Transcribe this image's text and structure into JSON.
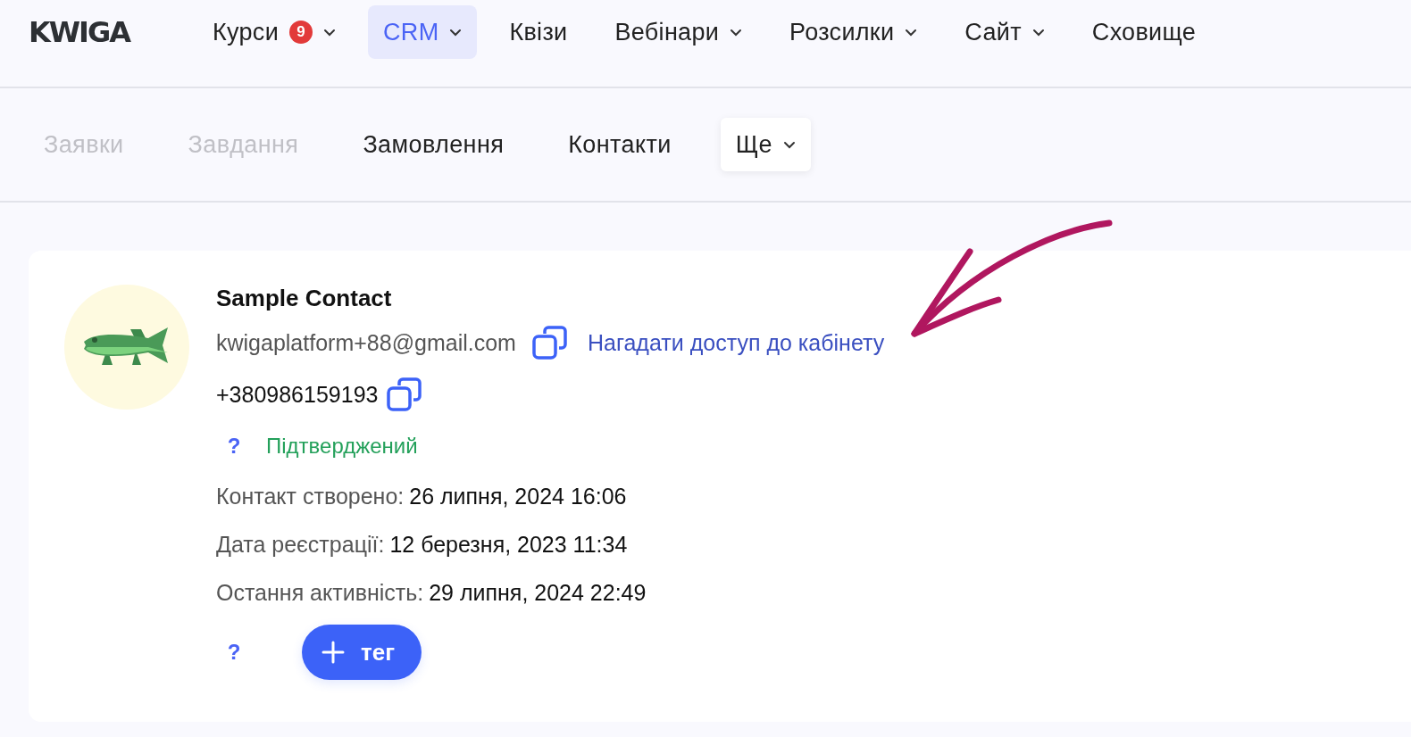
{
  "logo": "KWIGA",
  "nav": [
    {
      "label": "Курси",
      "badge": "9",
      "dropdown": true,
      "selected": false
    },
    {
      "label": "CRM",
      "dropdown": true,
      "selected": true
    },
    {
      "label": "Квізи",
      "dropdown": false,
      "selected": false
    },
    {
      "label": "Вебінари",
      "dropdown": true,
      "selected": false
    },
    {
      "label": "Розсилки",
      "dropdown": true,
      "selected": false
    },
    {
      "label": "Сайт",
      "dropdown": true,
      "selected": false
    },
    {
      "label": "Сховище",
      "dropdown": false,
      "selected": false
    }
  ],
  "subnav": [
    {
      "label": "Заявки",
      "kind": "link",
      "disabled": true
    },
    {
      "label": "Завдання",
      "kind": "link",
      "disabled": true
    },
    {
      "label": "Замовлення",
      "kind": "link",
      "disabled": false
    },
    {
      "label": "Контакти",
      "kind": "link",
      "disabled": false
    },
    {
      "label": "Ще",
      "kind": "menu",
      "disabled": false
    }
  ],
  "contact": {
    "name": "Sample Contact",
    "email": "kwigaplatform+88@gmail.com",
    "remind_link": "Нагадати доступ до кабінету",
    "phone": "+380986159193",
    "status_help": "?",
    "status": "Підтверджений",
    "info": [
      {
        "label": "Контакт створено:",
        "value": "26 липня, 2024 16:06"
      },
      {
        "label": "Дата реєстрації:",
        "value": "12 березня, 2023 11:34"
      },
      {
        "label": "Остання активність:",
        "value": "29 липня, 2024 22:49"
      }
    ],
    "tags_help": "?",
    "tag_button": "тег"
  }
}
